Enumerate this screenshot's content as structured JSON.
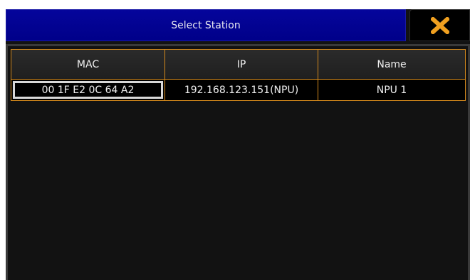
{
  "dialog": {
    "title": "Select Station",
    "close_icon": "close-x-icon",
    "close_color": "#f0a020"
  },
  "table": {
    "columns": [
      "MAC",
      "IP",
      "Name"
    ],
    "rows": [
      {
        "mac": "00 1F E2 0C 64 A2",
        "ip": "192.168.123.151(NPU)",
        "name": "NPU 1"
      }
    ]
  },
  "colors": {
    "title_bar": "#000089",
    "grid_border": "#d4891c",
    "background": "#121212"
  }
}
